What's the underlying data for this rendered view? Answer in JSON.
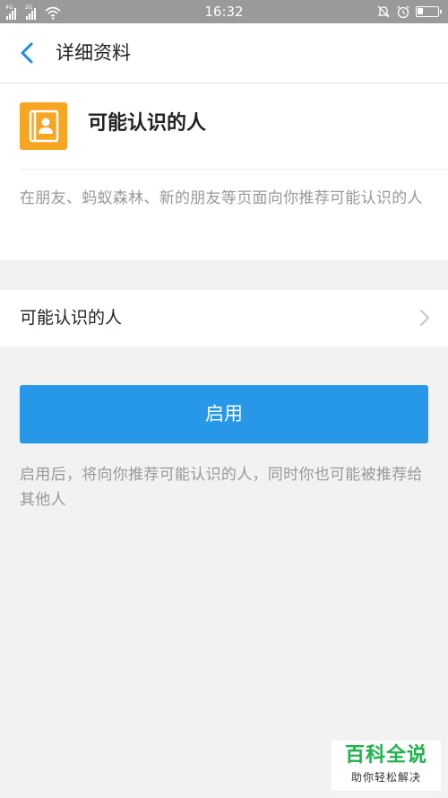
{
  "status_bar": {
    "network_1": "4G",
    "network_2": "2G",
    "time": "16:32",
    "battery_level": 0.3
  },
  "nav": {
    "title": "详细资料"
  },
  "app": {
    "name": "可能认识的人",
    "description": "在朋友、蚂蚁森林、新的朋友等页面向你推荐可能认识的人",
    "icon": "contact-book-icon",
    "icon_color": "#f6a623"
  },
  "settings_row": {
    "label": "可能认识的人"
  },
  "enable_button": {
    "label": "启用",
    "color": "#2797e8"
  },
  "note": "启用后，将向你推荐可能认识的人，同时你也可能被推荐给其他人",
  "watermark": {
    "title": "百科全说",
    "subtitle": "助你轻松解决"
  }
}
